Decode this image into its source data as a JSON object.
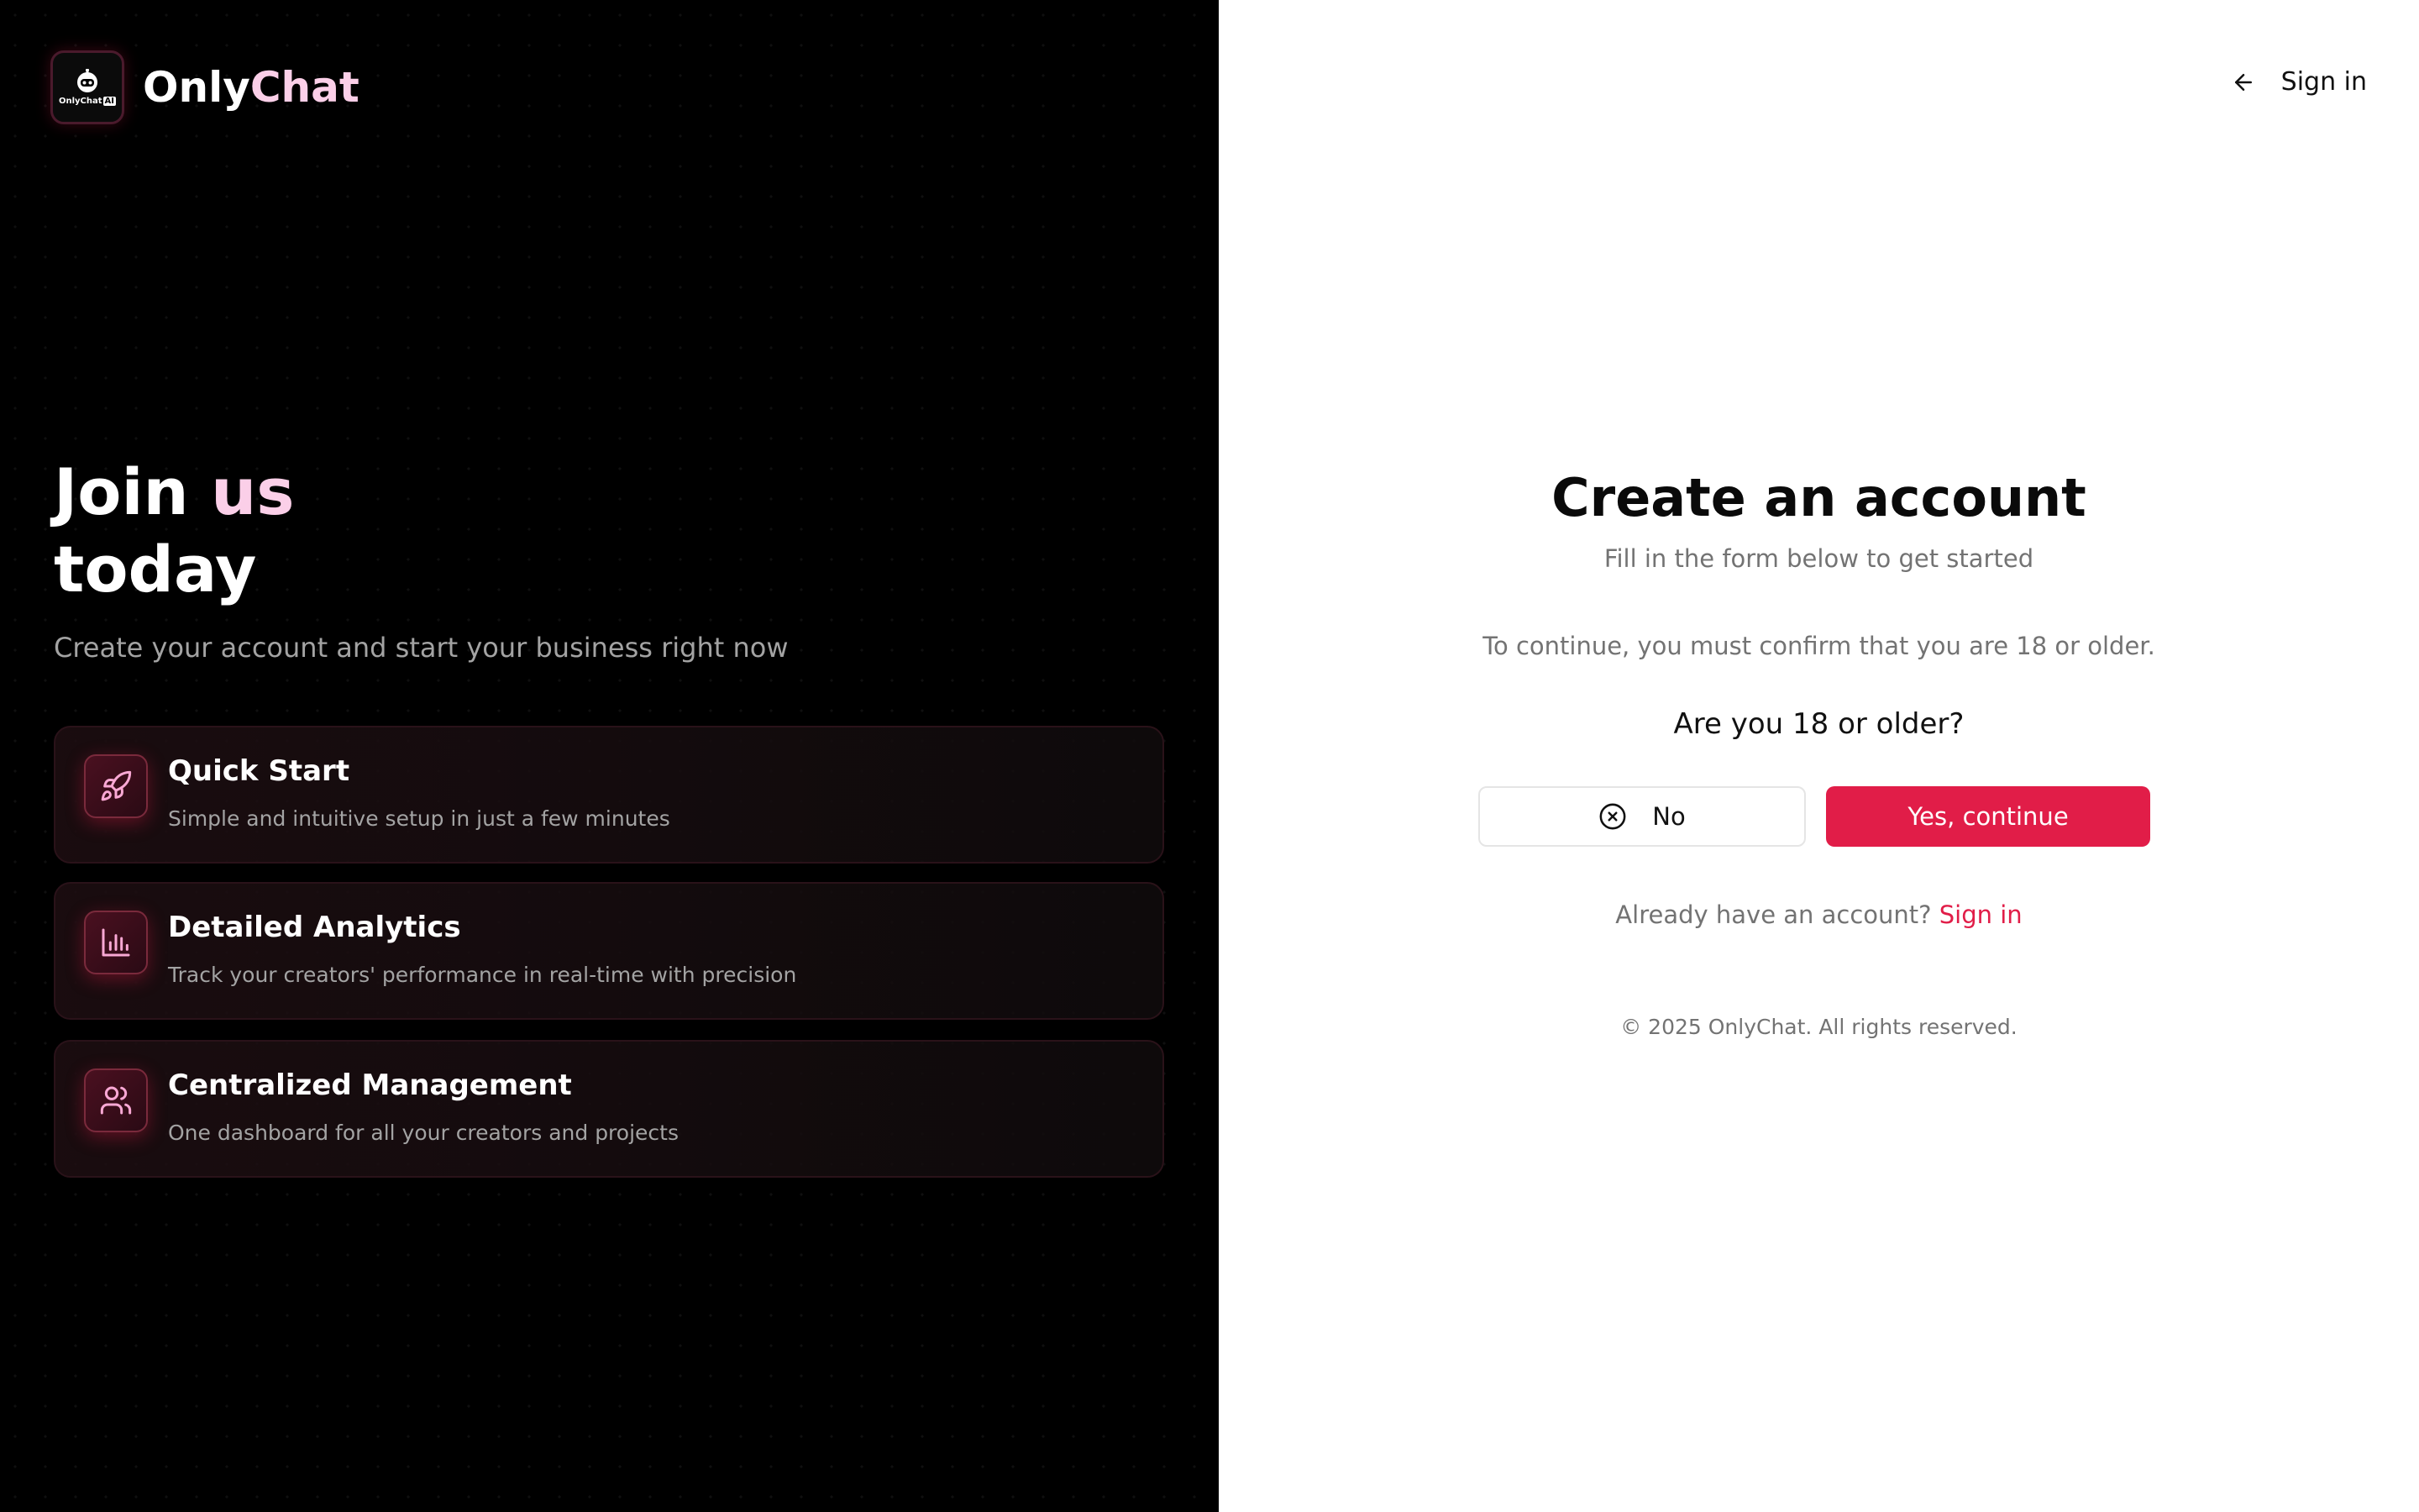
{
  "brand": {
    "name_primary": "Only",
    "name_accent": "Chat",
    "logo_text": "OnlyChat",
    "logo_badge": "AI",
    "colors": {
      "accent": "#e11d48",
      "accent_light": "#fbcfe8",
      "background_dark": "#000000"
    }
  },
  "hero": {
    "title_line1_primary": "Join",
    "title_line1_accent": "us",
    "title_line2": "today",
    "subtitle": "Create your account and start your business right now"
  },
  "features": [
    {
      "icon": "rocket-icon",
      "title": "Quick Start",
      "description": "Simple and intuitive setup in just a few minutes"
    },
    {
      "icon": "bar-chart-icon",
      "title": "Detailed Analytics",
      "description": "Track your creators' performance in real-time with precision"
    },
    {
      "icon": "users-icon",
      "title": "Centralized Management",
      "description": "One dashboard for all your creators and projects"
    }
  ],
  "header": {
    "back_label": "Sign in",
    "back_icon": "arrow-left-icon"
  },
  "form": {
    "title": "Create an account",
    "subtitle": "Fill in the form below to get started",
    "confirm_text": "To continue, you must confirm that you are 18 or older.",
    "question": "Are you 18 or older?",
    "no_label": "No",
    "no_icon": "x-circle-icon",
    "yes_label": "Yes, continue"
  },
  "footer": {
    "already_text": "Already have an account?",
    "signin_link": "Sign in",
    "copyright": "© 2025 OnlyChat. All rights reserved."
  }
}
